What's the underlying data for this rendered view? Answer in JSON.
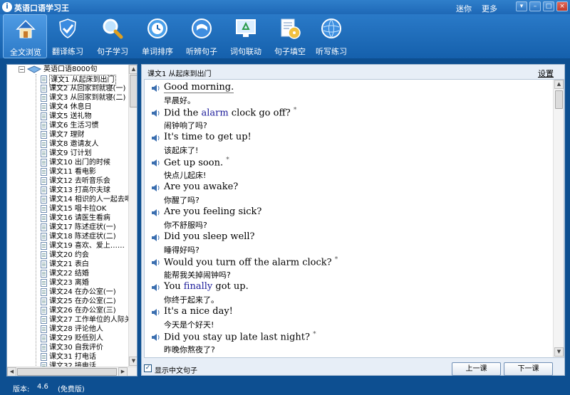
{
  "window": {
    "title": "英语口语学习王",
    "app_icon": "i",
    "links": [
      "迷你",
      "更多"
    ],
    "controls": [
      "▾",
      "–",
      "□",
      "×"
    ]
  },
  "toolbar": [
    {
      "label": "全文浏览",
      "icon": "house-icon",
      "active": true
    },
    {
      "label": "翻译练习",
      "icon": "shield-check-icon",
      "active": false
    },
    {
      "label": "句子学习",
      "icon": "magnifier-icon",
      "active": false
    },
    {
      "label": "单词排序",
      "icon": "clock-disc-icon",
      "active": false
    },
    {
      "label": "听辨句子",
      "icon": "play-disc-icon",
      "active": false
    },
    {
      "label": "词句联动",
      "icon": "recycle-monitor-icon",
      "active": false
    },
    {
      "label": "句子填空",
      "icon": "document-disc-icon",
      "active": false
    },
    {
      "label": "听写练习",
      "icon": "globe-icon",
      "active": false
    }
  ],
  "tree": {
    "root": "英语口语8000句",
    "items": [
      "课文1 从起床到出门",
      "课文2 从回家到就寝(一)",
      "课文3 从回家到就寝(二)",
      "课文4 休息日",
      "课文5 送礼物",
      "课文6 生活习惯",
      "课文7 理财",
      "课文8 邀请友人",
      "课文9 订计划",
      "课文10 出门的时候",
      "课文11 看电影",
      "课文12 去听音乐会",
      "课文13 打高尔夫球",
      "课文14 相识的人一起去喝",
      "课文15 唱卡拉OK",
      "课文16 请医生看病",
      "课文17 陈述症状(一)",
      "课文18 陈述症状(二)",
      "课文19 喜欢、爱上……",
      "课文20 约会",
      "课文21 表白",
      "课文22 结婚",
      "课文23 离婚",
      "课文24 在办公室(一)",
      "课文25 在办公室(二)",
      "课文26 在办公室(三)",
      "课文27 工作单位的人际关",
      "课文28 评论他人",
      "课文29 贬低别人",
      "课文30 自我评价",
      "课文31 打电话",
      "课文32 接电话"
    ],
    "selected_index": 0
  },
  "main": {
    "lesson_title": "课文1 从起床到出门",
    "settings": "设置",
    "sentences": [
      {
        "en": "Good morning.",
        "zh": "早晨好。",
        "star": false
      },
      {
        "en_parts": [
          "Did the ",
          "alarm",
          " clock go off?"
        ],
        "zh": "闹钟响了吗?",
        "star": true
      },
      {
        "en": "It's time to get up!",
        "zh": "该起床了!",
        "star": false
      },
      {
        "en": "Get up soon.",
        "zh": "快点儿起床!",
        "star": true
      },
      {
        "en": "Are you awake?",
        "zh": "你醒了吗?",
        "star": false
      },
      {
        "en": "Are you feeling sick?",
        "zh": "你不舒服吗?",
        "star": false
      },
      {
        "en": "Did you sleep well?",
        "zh": "睡得好吗?",
        "star": false
      },
      {
        "en": "Would you turn off the alarm clock?",
        "zh": "能帮我关掉闹钟吗?",
        "star": true
      },
      {
        "en_parts": [
          "You ",
          "finally",
          " got up."
        ],
        "zh": "你终于起来了。",
        "star": false
      },
      {
        "en": "It's a nice day!",
        "zh": "今天是个好天!",
        "star": false
      },
      {
        "en": "Did you stay up late last night?",
        "zh": "昨晚你熬夜了?",
        "star": true
      }
    ],
    "star_mark": "*",
    "show_chinese_label": "显示中文句子",
    "show_chinese_checked": true,
    "prev_label": "上一课",
    "next_label": "下一课"
  },
  "status": {
    "version_label": "版本:",
    "version": "4.6",
    "edition": "(免费版)"
  },
  "colors": {
    "titlebar": "#1e68b6",
    "toolbar": "#1560ac",
    "keyword": "#1a1a99",
    "statusbar": "#0d4f91"
  }
}
